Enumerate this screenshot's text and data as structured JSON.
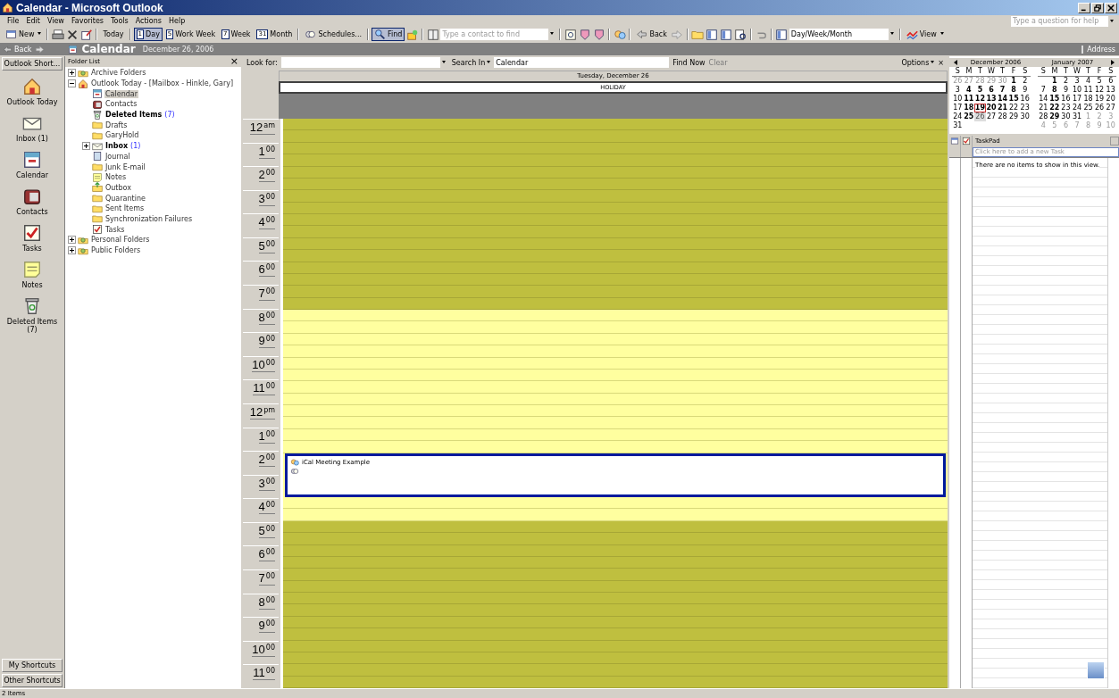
{
  "window": {
    "title": "Calendar - Microsoft Outlook"
  },
  "menu": [
    "File",
    "Edit",
    "View",
    "Favorites",
    "Tools",
    "Actions",
    "Help"
  ],
  "help_box": {
    "placeholder": "Type a question for help"
  },
  "toolbar": [
    {
      "kind": "button",
      "label": "New",
      "dropdown": true,
      "selected": false
    },
    {
      "kind": "sep"
    },
    {
      "kind": "icon"
    },
    {
      "kind": "icon"
    },
    {
      "kind": "icon"
    },
    {
      "kind": "sep"
    },
    {
      "kind": "button",
      "label": "Today",
      "dropdown": false,
      "selected": false
    },
    {
      "kind": "sep"
    },
    {
      "kind": "button",
      "badge": "1",
      "label": "Day",
      "dropdown": false,
      "selected": true
    },
    {
      "kind": "button",
      "badge": "5",
      "label": "Work Week",
      "dropdown": false,
      "selected": false
    },
    {
      "kind": "button",
      "badge": "7",
      "label": "Week",
      "dropdown": false,
      "selected": false
    },
    {
      "kind": "button",
      "badge": "31",
      "label": "Month",
      "dropdown": false,
      "selected": false
    },
    {
      "kind": "sep"
    },
    {
      "kind": "button",
      "label": "Schedules...",
      "dropdown": false,
      "selected": false
    },
    {
      "kind": "sep"
    },
    {
      "kind": "button",
      "label": "Find",
      "dropdown": false,
      "selected": true
    },
    {
      "kind": "icon"
    },
    {
      "kind": "sep"
    },
    {
      "kind": "icon"
    },
    {
      "kind": "field",
      "placeholder": "Type a contact to find"
    },
    {
      "kind": "sep"
    },
    {
      "kind": "icon"
    },
    {
      "kind": "icon"
    },
    {
      "kind": "icon"
    },
    {
      "kind": "sep"
    },
    {
      "kind": "icon"
    },
    {
      "kind": "sep"
    },
    {
      "kind": "button",
      "label": "Back",
      "dropdown": false,
      "selected": false
    },
    {
      "kind": "icon"
    },
    {
      "kind": "sep"
    },
    {
      "kind": "icon"
    },
    {
      "kind": "icon"
    },
    {
      "kind": "icon"
    },
    {
      "kind": "icon"
    },
    {
      "kind": "sep"
    },
    {
      "kind": "icon"
    },
    {
      "kind": "sep"
    },
    {
      "kind": "icon"
    },
    {
      "kind": "field",
      "value": "Day/Week/Month"
    },
    {
      "kind": "sep"
    },
    {
      "kind": "button",
      "label": "View",
      "dropdown": true,
      "selected": false
    }
  ],
  "navbar": {
    "back": "Back",
    "title": "Calendar",
    "date": "December 26, 2006",
    "address": "Address"
  },
  "shortcuts": {
    "header": "Outlook Short...",
    "items": [
      "Outlook Today",
      "Inbox (1)",
      "Calendar",
      "Contacts",
      "Tasks",
      "Notes",
      "Deleted Items (7)"
    ],
    "groups": [
      "My Shortcuts",
      "Other Shortcuts"
    ]
  },
  "folder_list": {
    "title": "Folder List",
    "close": "×",
    "tree": [
      {
        "label": "Archive Folders",
        "expanded": false,
        "bold": false,
        "selected": false
      },
      {
        "label": "Outlook Today - [Mailbox - Hinkle, Gary]",
        "expanded": true,
        "bold": false,
        "selected": false,
        "children": [
          {
            "label": "Calendar",
            "bold": false,
            "selected": true
          },
          {
            "label": "Contacts",
            "bold": false,
            "selected": false
          },
          {
            "label": "Deleted Items",
            "count": "(7)",
            "bold": true,
            "selected": false
          },
          {
            "label": "Drafts",
            "bold": false,
            "selected": false
          },
          {
            "label": "GaryHold",
            "bold": false,
            "selected": false
          },
          {
            "label": "Inbox",
            "count": "(1)",
            "expanded": false,
            "bold": true,
            "selected": false
          },
          {
            "label": "Journal",
            "bold": false,
            "selected": false
          },
          {
            "label": "Junk E-mail",
            "bold": false,
            "selected": false
          },
          {
            "label": "Notes",
            "bold": false,
            "selected": false
          },
          {
            "label": "Outbox",
            "bold": false,
            "selected": false
          },
          {
            "label": "Quarantine",
            "bold": false,
            "selected": false
          },
          {
            "label": "Sent Items",
            "bold": false,
            "selected": false
          },
          {
            "label": "Synchronization Failures",
            "bold": false,
            "selected": false
          },
          {
            "label": "Tasks",
            "bold": false,
            "selected": false
          }
        ]
      },
      {
        "label": "Personal Folders",
        "expanded": false,
        "bold": false,
        "selected": false
      },
      {
        "label": "Public Folders",
        "expanded": false,
        "bold": false,
        "selected": false
      }
    ]
  },
  "find_bar": {
    "look_for_label": "Look for:",
    "search_in": "Search In",
    "search_in_value": "Calendar",
    "find_now": "Find Now",
    "clear": {
      "label": "Clear",
      "disabled": true
    },
    "options": "Options",
    "close": "×"
  },
  "day_view": {
    "day_header": "Tuesday, December 26",
    "all_day_event": "HOLIDAY",
    "hours": [
      {
        "hour": "12",
        "suffix": "am",
        "working": false
      },
      {
        "hour": "1",
        "suffix": "00",
        "working": false
      },
      {
        "hour": "2",
        "suffix": "00",
        "working": false
      },
      {
        "hour": "3",
        "suffix": "00",
        "working": false
      },
      {
        "hour": "4",
        "suffix": "00",
        "working": false
      },
      {
        "hour": "5",
        "suffix": "00",
        "working": false
      },
      {
        "hour": "6",
        "suffix": "00",
        "working": false
      },
      {
        "hour": "7",
        "suffix": "00",
        "working": false
      },
      {
        "hour": "8",
        "suffix": "00",
        "working": true
      },
      {
        "hour": "9",
        "suffix": "00",
        "working": true
      },
      {
        "hour": "10",
        "suffix": "00",
        "working": true
      },
      {
        "hour": "11",
        "suffix": "00",
        "working": true
      },
      {
        "hour": "12",
        "suffix": "pm",
        "working": true
      },
      {
        "hour": "1",
        "suffix": "00",
        "working": true
      },
      {
        "hour": "2",
        "suffix": "00",
        "working": true
      },
      {
        "hour": "3",
        "suffix": "00",
        "working": true
      },
      {
        "hour": "4",
        "suffix": "00",
        "working": true
      },
      {
        "hour": "5",
        "suffix": "00",
        "working": false
      },
      {
        "hour": "6",
        "suffix": "00",
        "working": false
      },
      {
        "hour": "7",
        "suffix": "00",
        "working": false
      },
      {
        "hour": "8",
        "suffix": "00",
        "working": false
      },
      {
        "hour": "9",
        "suffix": "00",
        "working": false
      },
      {
        "hour": "10",
        "suffix": "00",
        "working": false
      },
      {
        "hour": "11",
        "suffix": "00",
        "working": false
      }
    ],
    "appointments": [
      {
        "title": "iCal Meeting Example",
        "selected": true,
        "recurring": true
      }
    ]
  },
  "date_navigator": {
    "months": [
      {
        "title": "December 2006",
        "weekdays": [
          "S",
          "M",
          "T",
          "W",
          "T",
          "F",
          "S"
        ],
        "weeks": [
          [
            {
              "d": "26",
              "muted": true,
              "bold": false,
              "today": false,
              "selected": false
            },
            {
              "d": "27",
              "muted": true,
              "bold": false,
              "today": false,
              "selected": false
            },
            {
              "d": "28",
              "muted": true,
              "bold": false,
              "today": false,
              "selected": false
            },
            {
              "d": "29",
              "muted": true,
              "bold": false,
              "today": false,
              "selected": false
            },
            {
              "d": "30",
              "muted": true,
              "bold": false,
              "today": false,
              "selected": false
            },
            {
              "d": "1",
              "muted": false,
              "bold": true,
              "today": false,
              "selected": false
            },
            {
              "d": "2",
              "muted": false,
              "bold": false,
              "today": false,
              "selected": false
            }
          ],
          [
            {
              "d": "3",
              "muted": false,
              "bold": false,
              "today": false,
              "selected": false
            },
            {
              "d": "4",
              "muted": false,
              "bold": true,
              "today": false,
              "selected": false
            },
            {
              "d": "5",
              "muted": false,
              "bold": true,
              "today": false,
              "selected": false
            },
            {
              "d": "6",
              "muted": false,
              "bold": true,
              "today": false,
              "selected": false
            },
            {
              "d": "7",
              "muted": false,
              "bold": true,
              "today": false,
              "selected": false
            },
            {
              "d": "8",
              "muted": false,
              "bold": true,
              "today": false,
              "selected": false
            },
            {
              "d": "9",
              "muted": false,
              "bold": false,
              "today": false,
              "selected": false
            }
          ],
          [
            {
              "d": "10",
              "muted": false,
              "bold": false,
              "today": false,
              "selected": false
            },
            {
              "d": "11",
              "muted": false,
              "bold": true,
              "today": false,
              "selected": false
            },
            {
              "d": "12",
              "muted": false,
              "bold": true,
              "today": false,
              "selected": false
            },
            {
              "d": "13",
              "muted": false,
              "bold": true,
              "today": false,
              "selected": false
            },
            {
              "d": "14",
              "muted": false,
              "bold": true,
              "today": false,
              "selected": false
            },
            {
              "d": "15",
              "muted": false,
              "bold": true,
              "today": false,
              "selected": false
            },
            {
              "d": "16",
              "muted": false,
              "bold": false,
              "today": false,
              "selected": false
            }
          ],
          [
            {
              "d": "17",
              "muted": false,
              "bold": false,
              "today": false,
              "selected": false
            },
            {
              "d": "18",
              "muted": false,
              "bold": true,
              "today": false,
              "selected": false
            },
            {
              "d": "19",
              "muted": false,
              "bold": true,
              "today": true,
              "selected": false
            },
            {
              "d": "20",
              "muted": false,
              "bold": true,
              "today": false,
              "selected": false
            },
            {
              "d": "21",
              "muted": false,
              "bold": true,
              "today": false,
              "selected": false
            },
            {
              "d": "22",
              "muted": false,
              "bold": false,
              "today": false,
              "selected": false
            },
            {
              "d": "23",
              "muted": false,
              "bold": false,
              "today": false,
              "selected": false
            }
          ],
          [
            {
              "d": "24",
              "muted": false,
              "bold": false,
              "today": false,
              "selected": false
            },
            {
              "d": "25",
              "muted": false,
              "bold": true,
              "today": false,
              "selected": false
            },
            {
              "d": "26",
              "muted": false,
              "bold": false,
              "today": false,
              "selected": true
            },
            {
              "d": "27",
              "muted": false,
              "bold": false,
              "today": false,
              "selected": false
            },
            {
              "d": "28",
              "muted": false,
              "bold": false,
              "today": false,
              "selected": false
            },
            {
              "d": "29",
              "muted": false,
              "bold": false,
              "today": false,
              "selected": false
            },
            {
              "d": "30",
              "muted": false,
              "bold": false,
              "today": false,
              "selected": false
            }
          ],
          [
            {
              "d": "31",
              "muted": false,
              "bold": false,
              "today": false,
              "selected": false
            }
          ]
        ]
      },
      {
        "title": "January 2007",
        "weekdays": [
          "S",
          "M",
          "T",
          "W",
          "T",
          "F",
          "S"
        ],
        "weeks": [
          [
            {
              "d": "1",
              "muted": false,
              "bold": true,
              "today": false,
              "selected": false
            },
            {
              "d": "2",
              "muted": false,
              "bold": false,
              "today": false,
              "selected": false
            },
            {
              "d": "3",
              "muted": false,
              "bold": false,
              "today": false,
              "selected": false
            },
            {
              "d": "4",
              "muted": false,
              "bold": false,
              "today": false,
              "selected": false
            },
            {
              "d": "5",
              "muted": false,
              "bold": false,
              "today": false,
              "selected": false
            },
            {
              "d": "6",
              "muted": false,
              "bold": false,
              "today": false,
              "selected": false
            }
          ],
          [
            {
              "d": "7",
              "muted": false,
              "bold": false,
              "today": false,
              "selected": false
            },
            {
              "d": "8",
              "muted": false,
              "bold": true,
              "today": false,
              "selected": false
            },
            {
              "d": "9",
              "muted": false,
              "bold": false,
              "today": false,
              "selected": false
            },
            {
              "d": "10",
              "muted": false,
              "bold": false,
              "today": false,
              "selected": false
            },
            {
              "d": "11",
              "muted": false,
              "bold": false,
              "today": false,
              "selected": false
            },
            {
              "d": "12",
              "muted": false,
              "bold": false,
              "today": false,
              "selected": false
            },
            {
              "d": "13",
              "muted": false,
              "bold": false,
              "today": false,
              "selected": false
            }
          ],
          [
            {
              "d": "14",
              "muted": false,
              "bold": false,
              "today": false,
              "selected": false
            },
            {
              "d": "15",
              "muted": false,
              "bold": true,
              "today": false,
              "selected": false
            },
            {
              "d": "16",
              "muted": false,
              "bold": false,
              "today": false,
              "selected": false
            },
            {
              "d": "17",
              "muted": false,
              "bold": false,
              "today": false,
              "selected": false
            },
            {
              "d": "18",
              "muted": false,
              "bold": false,
              "today": false,
              "selected": false
            },
            {
              "d": "19",
              "muted": false,
              "bold": false,
              "today": false,
              "selected": false
            },
            {
              "d": "20",
              "muted": false,
              "bold": false,
              "today": false,
              "selected": false
            }
          ],
          [
            {
              "d": "21",
              "muted": false,
              "bold": false,
              "today": false,
              "selected": false
            },
            {
              "d": "22",
              "muted": false,
              "bold": true,
              "today": false,
              "selected": false
            },
            {
              "d": "23",
              "muted": false,
              "bold": false,
              "today": false,
              "selected": false
            },
            {
              "d": "24",
              "muted": false,
              "bold": false,
              "today": false,
              "selected": false
            },
            {
              "d": "25",
              "muted": false,
              "bold": false,
              "today": false,
              "selected": false
            },
            {
              "d": "26",
              "muted": false,
              "bold": false,
              "today": false,
              "selected": false
            },
            {
              "d": "27",
              "muted": false,
              "bold": false,
              "today": false,
              "selected": false
            }
          ],
          [
            {
              "d": "28",
              "muted": false,
              "bold": false,
              "today": false,
              "selected": false
            },
            {
              "d": "29",
              "muted": false,
              "bold": true,
              "today": false,
              "selected": false
            },
            {
              "d": "30",
              "muted": false,
              "bold": false,
              "today": false,
              "selected": false
            },
            {
              "d": "31",
              "muted": false,
              "bold": false,
              "today": false,
              "selected": false
            },
            {
              "d": "1",
              "muted": true,
              "bold": false,
              "today": false,
              "selected": false
            },
            {
              "d": "2",
              "muted": true,
              "bold": false,
              "today": false,
              "selected": false
            },
            {
              "d": "3",
              "muted": true,
              "bold": false,
              "today": false,
              "selected": false
            }
          ],
          [
            {
              "d": "4",
              "muted": true,
              "bold": false,
              "today": false,
              "selected": false
            },
            {
              "d": "5",
              "muted": true,
              "bold": false,
              "today": false,
              "selected": false
            },
            {
              "d": "6",
              "muted": true,
              "bold": false,
              "today": false,
              "selected": false
            },
            {
              "d": "7",
              "muted": true,
              "bold": false,
              "today": false,
              "selected": false
            },
            {
              "d": "8",
              "muted": true,
              "bold": false,
              "today": false,
              "selected": false
            },
            {
              "d": "9",
              "muted": true,
              "bold": false,
              "today": false,
              "selected": false
            },
            {
              "d": "10",
              "muted": true,
              "bold": false,
              "today": false,
              "selected": false
            }
          ]
        ]
      }
    ]
  },
  "taskpad": {
    "title": "TaskPad",
    "new_task": {
      "placeholder": "Click here to add a new Task"
    },
    "empty_message": "There are no items to show in this view."
  },
  "status_bar": "2 Items"
}
